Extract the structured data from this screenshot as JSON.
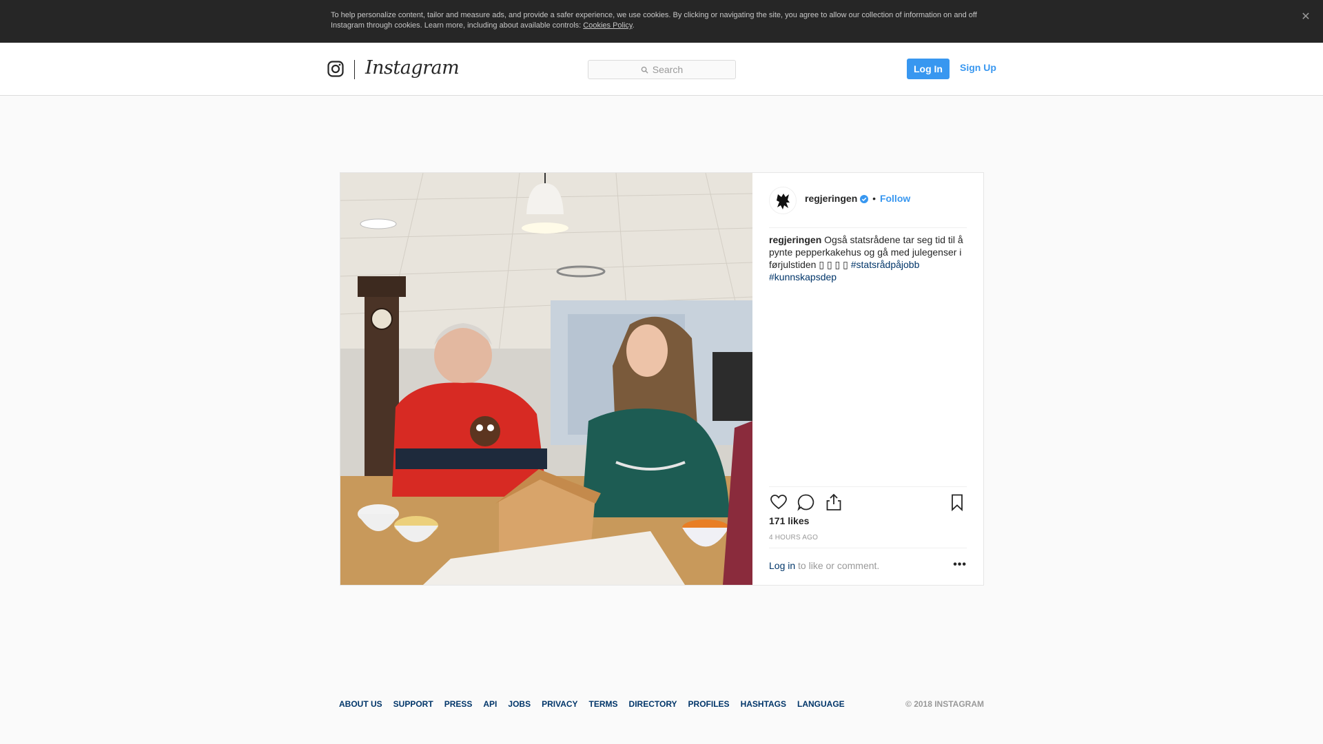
{
  "cookie_banner": {
    "text": "To help personalize content, tailor and measure ads, and provide a safer experience, we use cookies. By clicking or navigating the site, you agree to allow our collection of information on and off Instagram through cookies. Learn more, including about available controls: ",
    "link": "Cookies Policy",
    "close_icon": "close-icon"
  },
  "header": {
    "logo_text": "Instagram",
    "search_placeholder": "Search",
    "login_label": "Log In",
    "signup_label": "Sign Up"
  },
  "post": {
    "username": "regjeringen",
    "separator": "•",
    "follow_label": "Follow",
    "caption_user": "regjeringen",
    "caption_text": "Også statsrådene tar seg tid til å pynte pepperkakehus og gå med julegenser i førjulstiden ▯ ▯ ▯ ▯ ",
    "hashtags": [
      "#statsrådpåjobb",
      "#kunnskapsdep"
    ],
    "likes": "171 likes",
    "time": "4 HOURS AGO",
    "comment_login": "Log in",
    "comment_rest": " to like or comment.",
    "more": "•••",
    "colors": {
      "accent": "#3897f0",
      "link": "#003569",
      "muted": "#999999"
    }
  },
  "footer": {
    "links": [
      "ABOUT US",
      "SUPPORT",
      "PRESS",
      "API",
      "JOBS",
      "PRIVACY",
      "TERMS",
      "DIRECTORY",
      "PROFILES",
      "HASHTAGS",
      "LANGUAGE"
    ],
    "copyright": "© 2018 INSTAGRAM"
  }
}
